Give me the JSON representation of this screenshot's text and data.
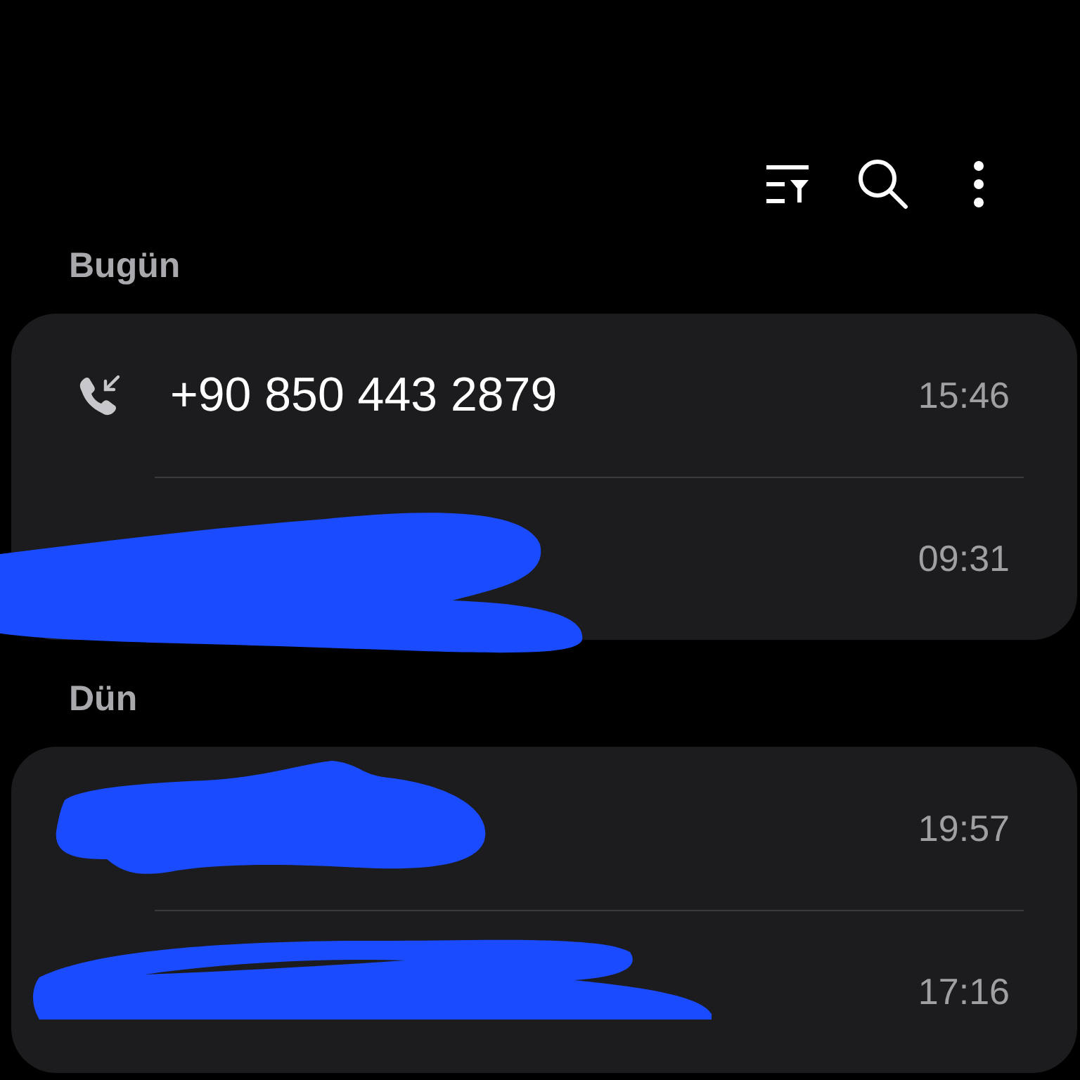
{
  "toolbar": {
    "buttons": [
      {
        "kind": "filter"
      },
      {
        "kind": "search"
      },
      {
        "kind": "more"
      }
    ]
  },
  "sections": [
    {
      "title": "Bugün",
      "calls": [
        {
          "kind": "number",
          "name": "+90 850 443 2879",
          "time": "15:46"
        },
        {
          "kind": "redacted",
          "time": "09:31"
        }
      ]
    },
    {
      "title": "Dün",
      "calls": [
        {
          "kind": "redacted",
          "time": "19:57"
        },
        {
          "kind": "redacted",
          "time": "17:16"
        }
      ]
    }
  ]
}
